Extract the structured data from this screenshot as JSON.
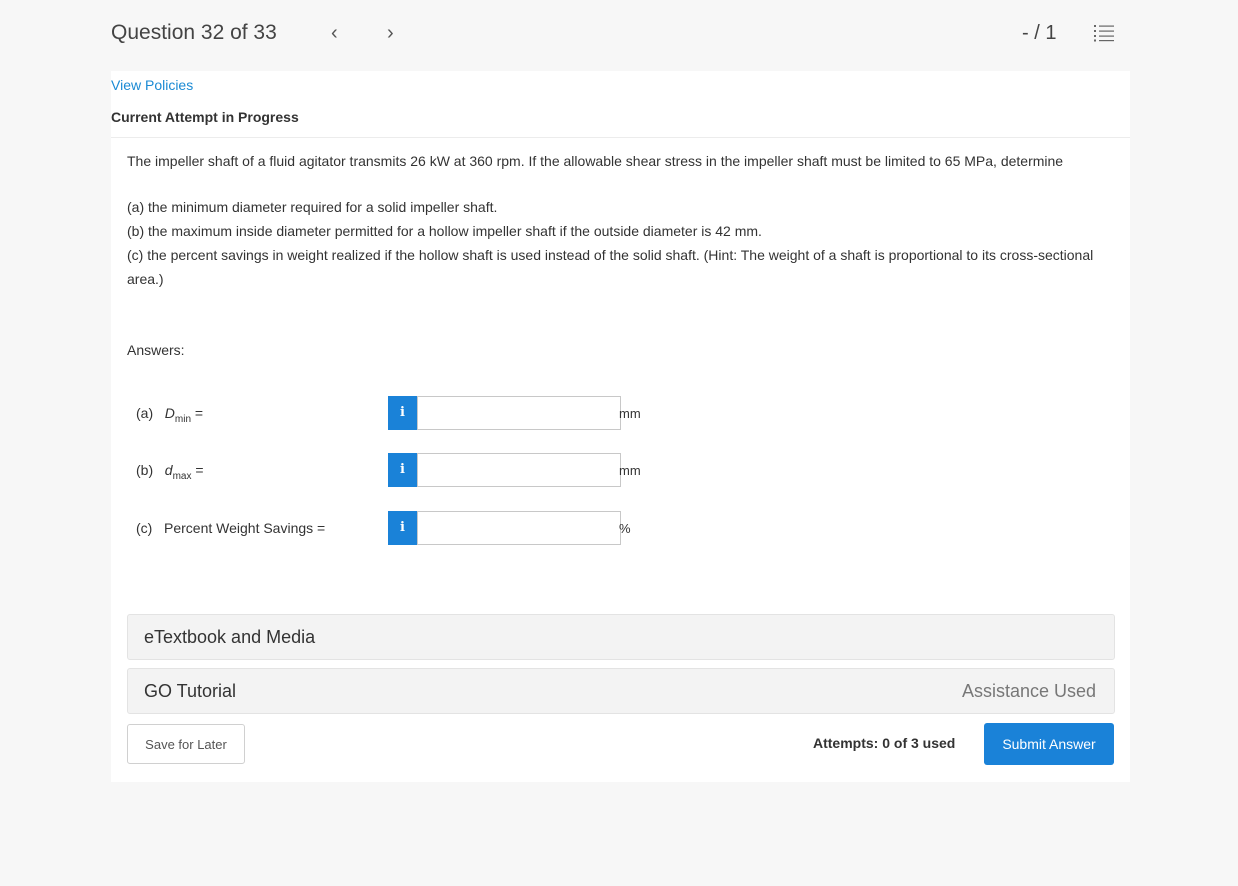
{
  "header": {
    "question_label": "Question 32 of 33",
    "prev_glyph": "‹",
    "next_glyph": "›",
    "score": "- / 1",
    "list_icon": "list-icon"
  },
  "card": {
    "policies_link": "View Policies",
    "attempt_title": "Current Attempt in Progress",
    "question": {
      "intro": "The impeller shaft of a fluid agitator transmits 26 kW at 360 rpm. If the allowable shear stress in the impeller shaft must be limited to 65 MPa, determine",
      "part_a": "(a) the minimum diameter required for a solid impeller shaft.",
      "part_b": "(b) the maximum inside diameter permitted for a hollow impeller shaft if the outside diameter is 42 mm.",
      "part_c": "(c) the percent savings in weight realized if the hollow shaft is used instead of the solid shaft. (Hint: The weight of a shaft is proportional to its cross-sectional area.)"
    },
    "answers_label": "Answers:",
    "answers": [
      {
        "prefix": "(a)",
        "var": "D",
        "sub": "min",
        "suffix": " =",
        "value": "",
        "unit": "mm"
      },
      {
        "prefix": "(b)",
        "var": "d",
        "sub": "max",
        "suffix": " =",
        "value": "",
        "unit": "mm"
      },
      {
        "prefix": "(c)",
        "text": "Percent Weight Savings =",
        "value": "",
        "unit": "%"
      }
    ],
    "info_glyph": "i",
    "etextbook": "eTextbook and Media",
    "go_tutorial": "GO Tutorial",
    "assistance_used": "Assistance Used",
    "save_label": "Save for Later",
    "attempts_text": "Attempts: 0 of 3 used",
    "submit_label": "Submit Answer"
  }
}
